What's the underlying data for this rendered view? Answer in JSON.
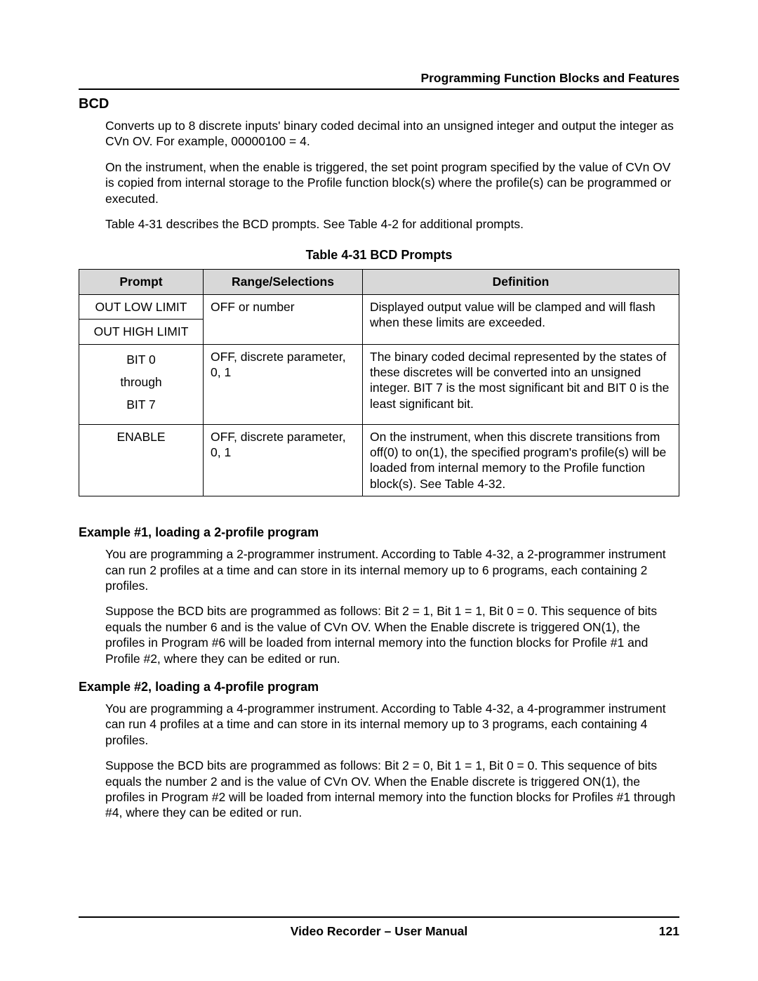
{
  "header": {
    "running": "Programming Function Blocks and Features"
  },
  "section": {
    "title": "BCD",
    "p1": "Converts up to 8 discrete inputs' binary coded decimal into an unsigned integer and output the integer as CVn OV.  For example, 00000100 = 4.",
    "p2": "On the instrument, when the enable is triggered, the set point program specified by the value of CVn OV is copied from internal storage to the Profile function block(s) where the profile(s) can be programmed or executed.",
    "p3": "Table 4-31 describes the BCD prompts. See Table 4-2 for additional prompts."
  },
  "table": {
    "caption": "Table 4-31   BCD Prompts",
    "headers": {
      "c1": "Prompt",
      "c2": "Range/Selections",
      "c3": "Definition"
    },
    "r1": {
      "prompt": "OUT LOW LIMIT",
      "range": "OFF or number",
      "defn": "Displayed output value will be clamped and will flash when these limits are exceeded."
    },
    "r2": {
      "prompt": "OUT HIGH LIMIT"
    },
    "r3": {
      "prompt_a": "BIT 0",
      "prompt_b": "through",
      "prompt_c": "BIT 7",
      "range": "OFF, discrete parameter, 0, 1",
      "defn": "The binary coded decimal represented by the states of these discretes will be converted into an unsigned integer.  BIT 7 is the most significant bit and BIT 0 is the least significant bit."
    },
    "r4": {
      "prompt": "ENABLE",
      "range": "OFF, discrete parameter, 0, 1",
      "defn": "On the instrument, when this discrete transitions from off(0) to on(1), the specified program's profile(s) will be loaded from internal memory to the Profile function block(s).  See Table 4-32."
    }
  },
  "ex1": {
    "title": "Example #1, loading a 2-profile program",
    "p1": "You are programming a 2-programmer instrument.  According to Table 4-32, a 2-programmer instrument can run 2 profiles at a time and can store in its internal memory up to 6 programs, each containing 2 profiles.",
    "p2": "Suppose the BCD bits are programmed as follows: Bit 2 = 1, Bit 1 = 1, Bit 0 = 0.  This sequence of bits equals the number 6 and is the value of CVn OV.  When the Enable discrete is triggered ON(1), the profiles in Program #6 will be loaded from internal memory into the function blocks for Profile #1 and Profile #2, where they can be edited or run."
  },
  "ex2": {
    "title": "Example #2, loading a 4-profile program",
    "p1": "You are programming a 4-programmer instrument.  According to Table 4-32, a 4-programmer instrument can run 4 profiles at a time and can store in its internal memory up to 3 programs, each containing 4 profiles.",
    "p2": "Suppose the BCD bits are programmed as follows: Bit 2 = 0, Bit 1 = 1, Bit 0 = 0.  This sequence of bits equals the number 2 and is the value of CVn OV.  When the Enable discrete is triggered ON(1), the profiles in Program #2 will be loaded from internal memory into the function blocks for Profiles #1 through #4, where they can be edited or run."
  },
  "footer": {
    "center": "Video Recorder – User Manual",
    "page": "121"
  }
}
